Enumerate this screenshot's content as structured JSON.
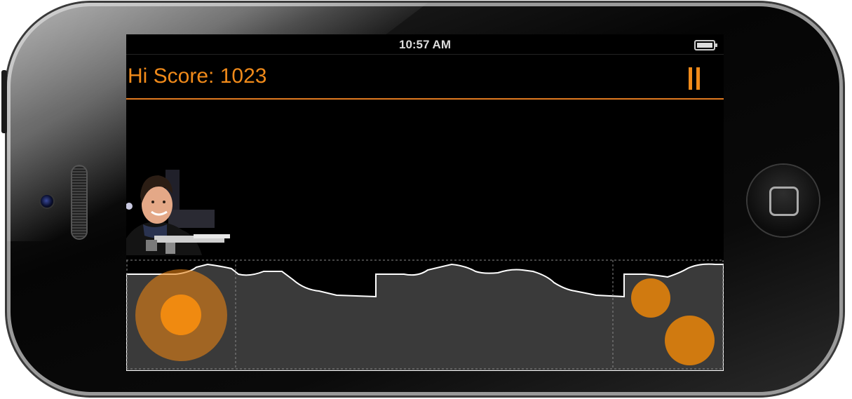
{
  "status_bar": {
    "time": "10:57 AM",
    "battery_icon": "battery-icon"
  },
  "hud": {
    "score_label": "Hi Score:",
    "score_value": "1023",
    "pause_icon": "pause-icon"
  },
  "colors": {
    "accent": "#f08a1a",
    "terrain": "#3a3a3a",
    "terrain_outline": "#ffffff",
    "screen_bg": "#000000"
  },
  "controls": {
    "joystick": "virtual-joystick",
    "buttons": [
      "fire-button-a",
      "fire-button-b"
    ]
  }
}
